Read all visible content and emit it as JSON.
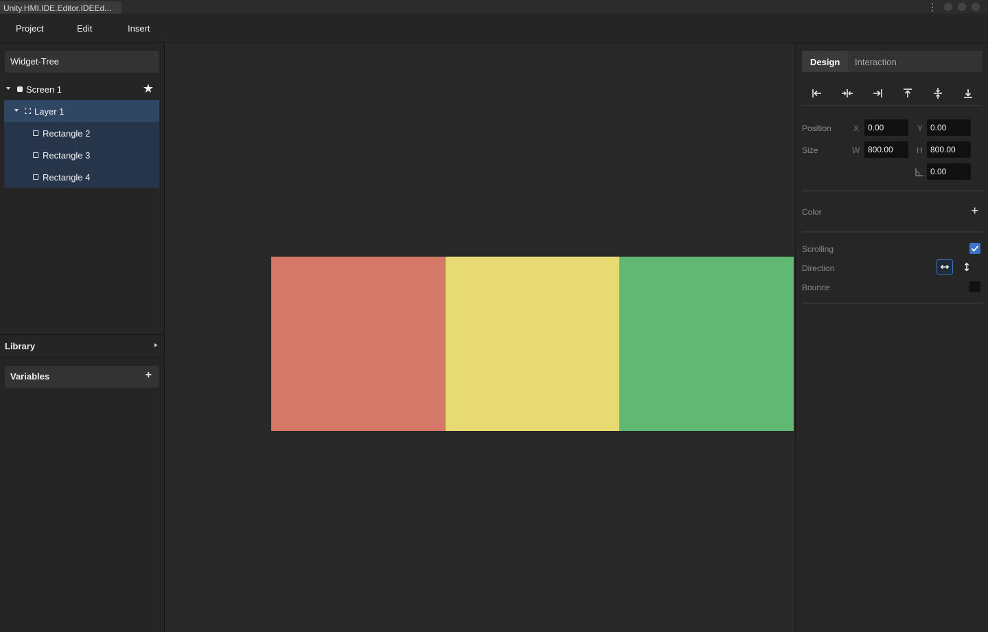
{
  "window": {
    "title": "Unity.HMI.IDE.Editor.IDEEd..."
  },
  "menu": {
    "items": [
      "Project",
      "Edit",
      "Insert"
    ]
  },
  "left_panel": {
    "widget_tree_title": "Widget-Tree",
    "tree": [
      {
        "label": "Screen 1"
      },
      {
        "label": "Layer 1"
      },
      {
        "label": "Rectangle 2"
      },
      {
        "label": "Rectangle 3"
      },
      {
        "label": "Rectangle 4"
      }
    ],
    "library_label": "Library",
    "variables_label": "Variables"
  },
  "canvas": {
    "rectangles": [
      {
        "name": "Rectangle 2",
        "color": "#d57868"
      },
      {
        "name": "Rectangle 3",
        "color": "#e8da72"
      },
      {
        "name": "Rectangle 4",
        "color": "#61b873"
      }
    ]
  },
  "right_panel": {
    "tabs": {
      "design": "Design",
      "interaction": "Interaction"
    },
    "position": {
      "label": "Position",
      "x_label": "X",
      "x": "0.00",
      "y_label": "Y",
      "y": "0.00"
    },
    "size": {
      "label": "Size",
      "w_label": "W",
      "w": "800.00",
      "h_label": "H",
      "h": "800.00",
      "corner": "0.00"
    },
    "color_label": "Color",
    "scrolling": {
      "label": "Scrolling",
      "checked": true
    },
    "direction": {
      "label": "Direction",
      "selected": "horizontal"
    },
    "bounce": {
      "label": "Bounce",
      "checked": false
    }
  },
  "colors": {
    "accent": "#3d74c9",
    "selection": "#2f4763"
  }
}
